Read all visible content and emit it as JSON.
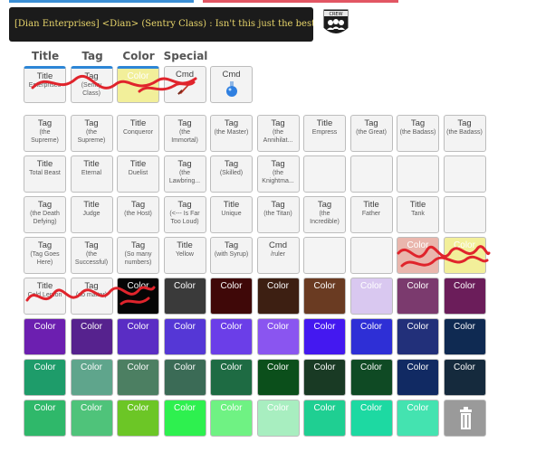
{
  "banner": {
    "text": "[Dian Enterprises] <Dian> (Sentry Class) : Isn't this just the best?",
    "badge_label": "CREW"
  },
  "headers": [
    "Title",
    "Tag",
    "Color",
    "Special"
  ],
  "colors": {
    "accent": "#2d86d6",
    "bar_left": "#3b8fd5",
    "bar_right": "#e25663",
    "banner_text": "#e9d66b"
  },
  "equipped": [
    {
      "kind": "Title",
      "sub": "Enterprises",
      "bg": "#f3f3f3"
    },
    {
      "kind": "Tag",
      "sub": "(Sentry Class)",
      "bg": "#f3f3f3"
    },
    {
      "kind": "Color",
      "sub": "",
      "bg": "#f2ef9a"
    },
    {
      "kind": "Cmd",
      "sub": "",
      "icon": "sword-icon",
      "bg": "#f3f3f3"
    },
    {
      "kind": "Cmd",
      "sub": "",
      "icon": "potion-icon",
      "bg": "#f3f3f3"
    }
  ],
  "grid": [
    [
      {
        "kind": "Tag",
        "sub": "(the Supreme)"
      },
      {
        "kind": "Tag",
        "sub": "(the Supreme)"
      },
      {
        "kind": "Title",
        "sub": "Conqueror"
      },
      {
        "kind": "Tag",
        "sub": "(the Immortal)"
      },
      {
        "kind": "Tag",
        "sub": "(the Master)"
      },
      {
        "kind": "Tag",
        "sub": "(the Annihilat..."
      },
      {
        "kind": "Title",
        "sub": "Empress"
      },
      {
        "kind": "Tag",
        "sub": "(the Great)"
      },
      {
        "kind": "Tag",
        "sub": "(the Badass)"
      },
      {
        "kind": "Tag",
        "sub": "(the Badass)"
      }
    ],
    [
      {
        "kind": "Title",
        "sub": "Total Beast"
      },
      {
        "kind": "Title",
        "sub": "Eternal"
      },
      {
        "kind": "Title",
        "sub": "Duelist"
      },
      {
        "kind": "Tag",
        "sub": "(the Lawbring..."
      },
      {
        "kind": "Tag",
        "sub": "(Skilled)"
      },
      {
        "kind": "Tag",
        "sub": "(the Knightma..."
      },
      {
        "kind": "",
        "sub": ""
      },
      {
        "kind": "",
        "sub": ""
      },
      {
        "kind": "",
        "sub": ""
      },
      {
        "kind": "",
        "sub": ""
      }
    ],
    [
      {
        "kind": "Tag",
        "sub": "(the Death Defying)"
      },
      {
        "kind": "Title",
        "sub": "Judge"
      },
      {
        "kind": "Tag",
        "sub": "(the Host)"
      },
      {
        "kind": "Tag",
        "sub": "(<--- Is Far Too Loud)"
      },
      {
        "kind": "Title",
        "sub": "Unique"
      },
      {
        "kind": "Tag",
        "sub": "(the Titan)"
      },
      {
        "kind": "Tag",
        "sub": "(the Incredible)"
      },
      {
        "kind": "Title",
        "sub": "Father"
      },
      {
        "kind": "Title",
        "sub": "Tank"
      },
      {
        "kind": "",
        "sub": ""
      }
    ],
    [
      {
        "kind": "Tag",
        "sub": "(Tag Goes Here)"
      },
      {
        "kind": "Tag",
        "sub": "(the Successful)"
      },
      {
        "kind": "Tag",
        "sub": "(So many numbers)"
      },
      {
        "kind": "Title",
        "sub": "Yellow"
      },
      {
        "kind": "Tag",
        "sub": "(with Syrup)"
      },
      {
        "kind": "Cmd",
        "sub": "/ruler"
      },
      {
        "kind": "",
        "sub": ""
      },
      {
        "kind": "",
        "sub": ""
      },
      {
        "kind": "Color",
        "sub": "",
        "bg": "#e9b6ad"
      },
      {
        "kind": "Color",
        "sub": "",
        "bg": "#f2ef9a"
      }
    ],
    [
      {
        "kind": "Title",
        "sub": "Cold Lemon"
      },
      {
        "kind": "Tag",
        "sub": "(no matter)"
      },
      {
        "kind": "Color",
        "sub": "",
        "bg": "#050505"
      },
      {
        "kind": "Color",
        "sub": "",
        "bg": "#3a3a3a"
      },
      {
        "kind": "Color",
        "sub": "",
        "bg": "#3f0808"
      },
      {
        "kind": "Color",
        "sub": "",
        "bg": "#3d1f12"
      },
      {
        "kind": "Color",
        "sub": "",
        "bg": "#6a3b22"
      },
      {
        "kind": "Color",
        "sub": "",
        "bg": "#d9c8f0"
      },
      {
        "kind": "Color",
        "sub": "",
        "bg": "#7b3a6e"
      },
      {
        "kind": "Color",
        "sub": "",
        "bg": "#6b1d5a"
      }
    ],
    [
      {
        "kind": "Color",
        "sub": "",
        "bg": "#6c1fb0"
      },
      {
        "kind": "Color",
        "sub": "",
        "bg": "#56228e"
      },
      {
        "kind": "Color",
        "sub": "",
        "bg": "#5a2dc4"
      },
      {
        "kind": "Color",
        "sub": "",
        "bg": "#5537d6"
      },
      {
        "kind": "Color",
        "sub": "",
        "bg": "#6b3ee8"
      },
      {
        "kind": "Color",
        "sub": "",
        "bg": "#8a55f0"
      },
      {
        "kind": "Color",
        "sub": "",
        "bg": "#4418f0"
      },
      {
        "kind": "Color",
        "sub": "",
        "bg": "#2e2fd6"
      },
      {
        "kind": "Color",
        "sub": "",
        "bg": "#22307a"
      },
      {
        "kind": "Color",
        "sub": "",
        "bg": "#0f2a52"
      }
    ],
    [
      {
        "kind": "Color",
        "sub": "",
        "bg": "#1e9c6a"
      },
      {
        "kind": "Color",
        "sub": "",
        "bg": "#5fa58c"
      },
      {
        "kind": "Color",
        "sub": "",
        "bg": "#4c7f62"
      },
      {
        "kind": "Color",
        "sub": "",
        "bg": "#3b6b56"
      },
      {
        "kind": "Color",
        "sub": "",
        "bg": "#1e6b43"
      },
      {
        "kind": "Color",
        "sub": "",
        "bg": "#0b4f1b"
      },
      {
        "kind": "Color",
        "sub": "",
        "bg": "#193a24"
      },
      {
        "kind": "Color",
        "sub": "",
        "bg": "#0f4a24"
      },
      {
        "kind": "Color",
        "sub": "",
        "bg": "#112a63"
      },
      {
        "kind": "Color",
        "sub": "",
        "bg": "#152a3d"
      }
    ],
    [
      {
        "kind": "Color",
        "sub": "",
        "bg": "#2fb86a"
      },
      {
        "kind": "Color",
        "sub": "",
        "bg": "#4fc37a"
      },
      {
        "kind": "Color",
        "sub": "",
        "bg": "#6cc626"
      },
      {
        "kind": "Color",
        "sub": "",
        "bg": "#2ef04f"
      },
      {
        "kind": "Color",
        "sub": "",
        "bg": "#6ff283"
      },
      {
        "kind": "Color",
        "sub": "",
        "bg": "#a8eec0"
      },
      {
        "kind": "Color",
        "sub": "",
        "bg": "#1fcf92"
      },
      {
        "kind": "Color",
        "sub": "",
        "bg": "#1dd9a2"
      },
      {
        "kind": "Color",
        "sub": "",
        "bg": "#44e3b0"
      },
      {
        "kind": "trash",
        "sub": "",
        "bg": "#9a9a9a",
        "icon": "trash-icon"
      }
    ]
  ]
}
